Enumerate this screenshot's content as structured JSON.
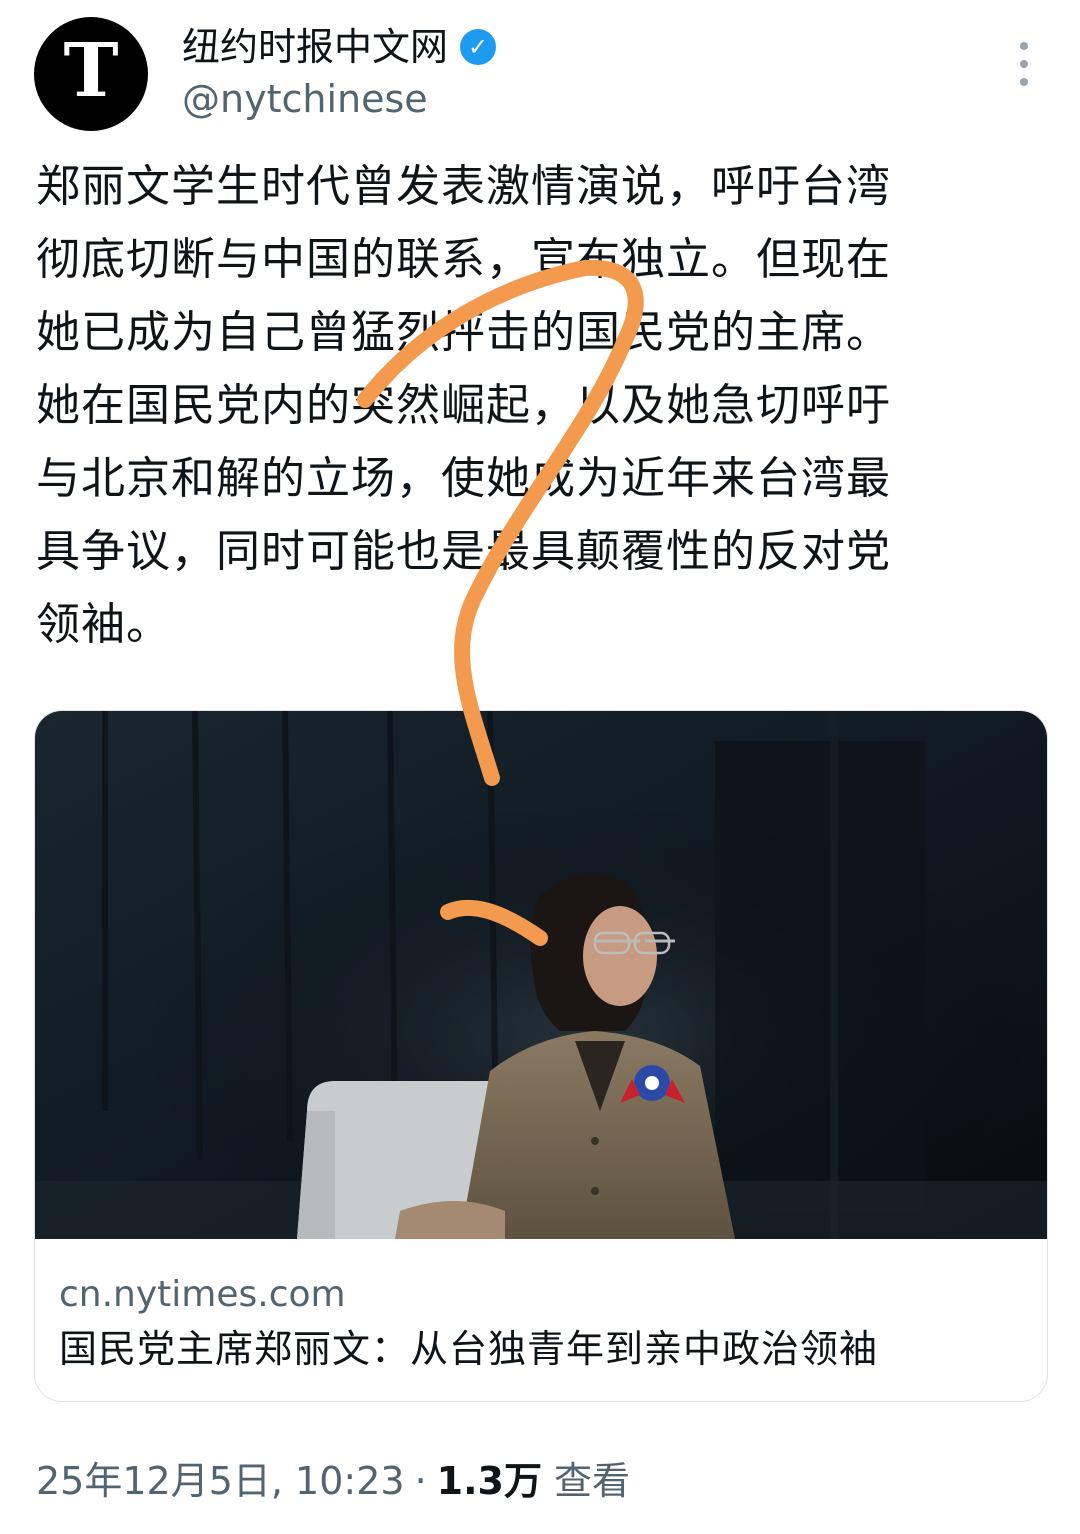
{
  "account": {
    "avatar_glyph": "T",
    "name": "纽约时报中文网",
    "verified_icon": "verified-badge-icon",
    "handle": "@nytchinese",
    "more_icon": "more-vertical-icon"
  },
  "tweet": {
    "lines": [
      "郑丽文学生时代曾发表激情演说，呼吁台湾",
      "彻底切断与中国的联系，宣布独立。但现在",
      "她已成为自己曾猛烈抨击的国民党的主席。",
      "她在国民党内的突然崛起，以及她急切呼吁",
      "与北京和解的立场，使她成为近年来台湾最",
      "具争议，同时可能也是最具颠覆性的反对党",
      "领袖。"
    ]
  },
  "link_card": {
    "domain": "cn.nytimes.com",
    "headline": "国民党主席郑丽文：从台独青年到亲中政治领袖"
  },
  "meta": {
    "timestamp": "25年12月5日, 10:23",
    "separator": "·",
    "views": "1.3万",
    "views_label": "查看"
  },
  "colors": {
    "primary_text": "#0f1419",
    "secondary_text": "#536471",
    "verified": "#1d9bf0",
    "annotation_stroke": "#f39a4f"
  }
}
